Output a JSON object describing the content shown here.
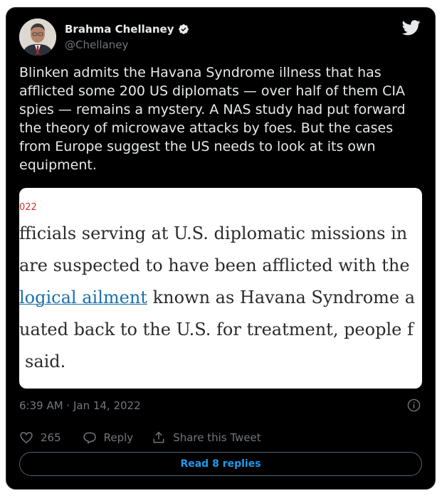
{
  "author": {
    "name": "Brahma Chellaney",
    "handle": "@Chellaney"
  },
  "tweet": {
    "text": "Blinken admits the Havana Syndrome illness that has afflicted some 200 US diplomats — over half of them CIA spies — remains a mystery. A NAS study had put forward the theory of microwave attacks by foes. But the cases from Europe suggest the US needs to look at its own equipment.",
    "timestamp": "6:39 AM · Jan 14, 2022"
  },
  "media": {
    "date_fragment": "022",
    "lines": [
      "fficials serving at U.S. diplomatic missions in",
      "are suspected to have been afflicted with the",
      "known as Havana Syndrome a",
      "uated back to the U.S. for treatment, people f",
      "said."
    ],
    "link_text": "logical ailment"
  },
  "actions": {
    "like_count": "265",
    "reply_label": "Reply",
    "share_label": "Share this Tweet"
  },
  "read_replies_label": "Read 8 replies",
  "colors": {
    "background": "#000000",
    "text": "#e7e9ea",
    "muted": "#71767b",
    "accent": "#1d9bf0",
    "link": "#1a6fad",
    "date_red": "#d3302f"
  },
  "icons": [
    "verified-badge-icon",
    "twitter-bird-icon",
    "info-icon",
    "heart-icon",
    "reply-bubble-icon",
    "share-icon"
  ]
}
